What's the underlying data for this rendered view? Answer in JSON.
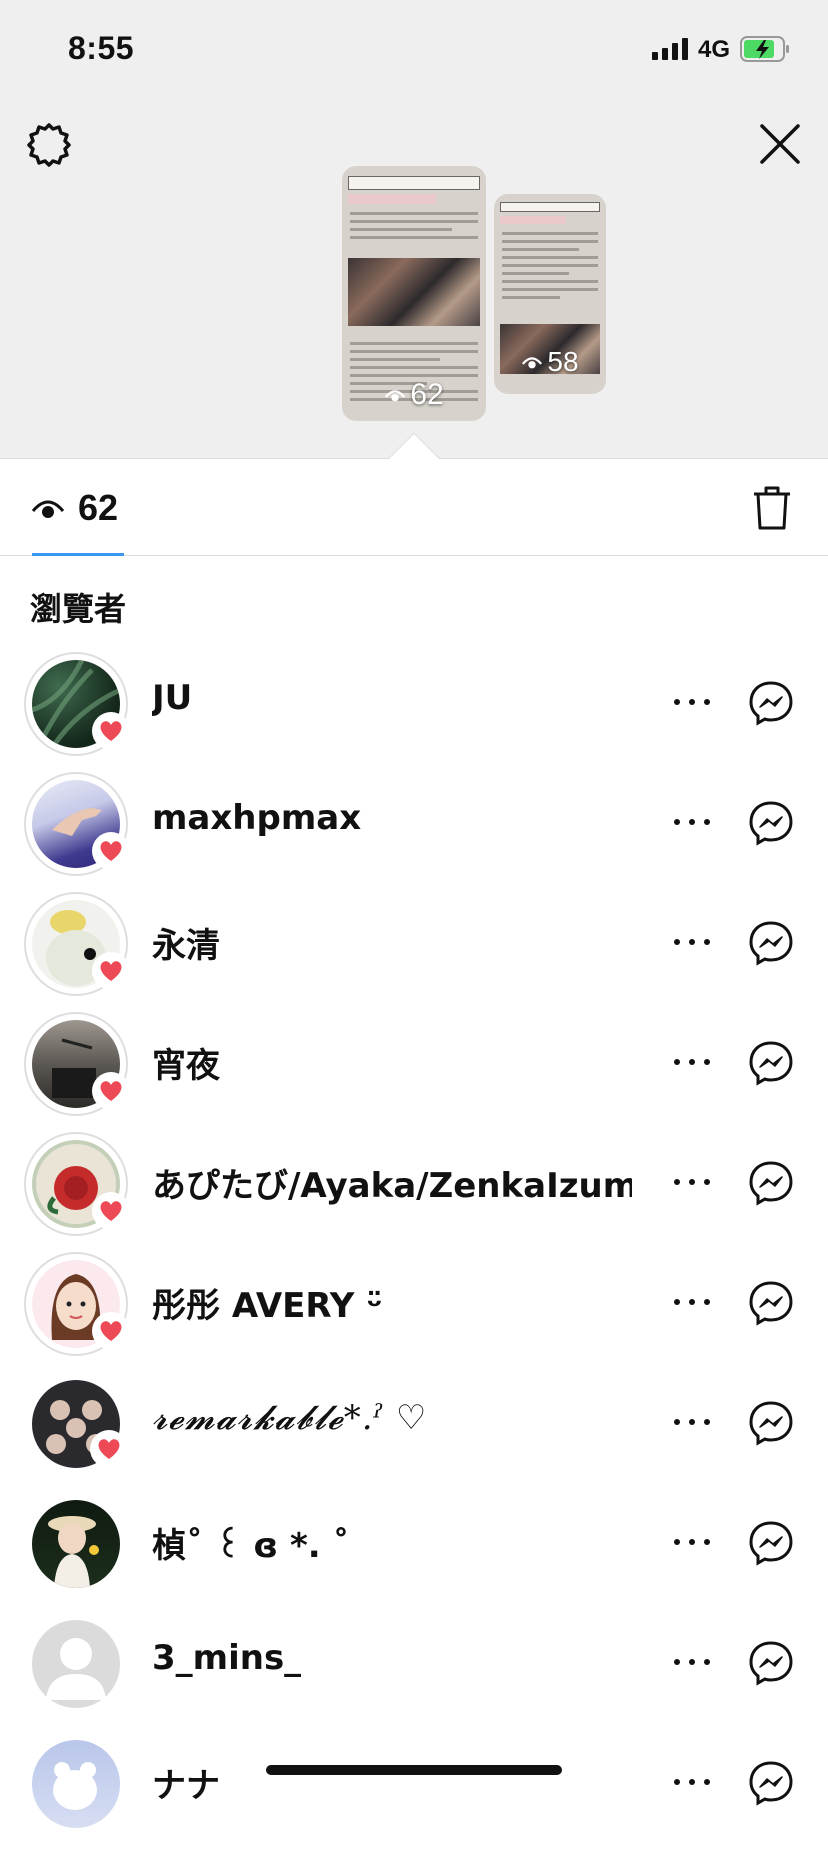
{
  "status_bar": {
    "time": "8:55",
    "network": "4G"
  },
  "stories": [
    {
      "view_count": "62"
    },
    {
      "view_count": "58"
    }
  ],
  "tab": {
    "view_count": "62"
  },
  "section_title": "瀏覽者",
  "viewers": [
    {
      "name": "JU",
      "liked": true,
      "avatar": "jungle-leaves"
    },
    {
      "name": "maxhpmax",
      "liked": true,
      "avatar": "hand-on-purple"
    },
    {
      "name": "永清",
      "liked": true,
      "avatar": "yellow-duck"
    },
    {
      "name": "宵夜",
      "liked": true,
      "avatar": "dark-room"
    },
    {
      "name": "あぴたび/Ayaka/ZenkaIzumi",
      "liked": true,
      "avatar": "red-rose-plate"
    },
    {
      "name": "彤彤 AVERY ᵕ̈",
      "liked": true,
      "avatar": "cartoon-girl"
    },
    {
      "name": "𝓻𝓮𝓶𝓪𝓻𝓴𝓪𝓫𝓵𝓮*.ˀ ♡",
      "liked": true,
      "avatar": "group-photo"
    },
    {
      "name": "楨˚ ꒰ ɞ *. ˚",
      "liked": false,
      "avatar": "girl-with-hat"
    },
    {
      "name": "3_mins_",
      "liked": false,
      "avatar": "default"
    },
    {
      "name": "ナナ",
      "liked": false,
      "avatar": "blue-bear"
    }
  ],
  "colors": {
    "accent": "#3897f0",
    "heart": "#ed4956",
    "background_top": "#efefef"
  }
}
